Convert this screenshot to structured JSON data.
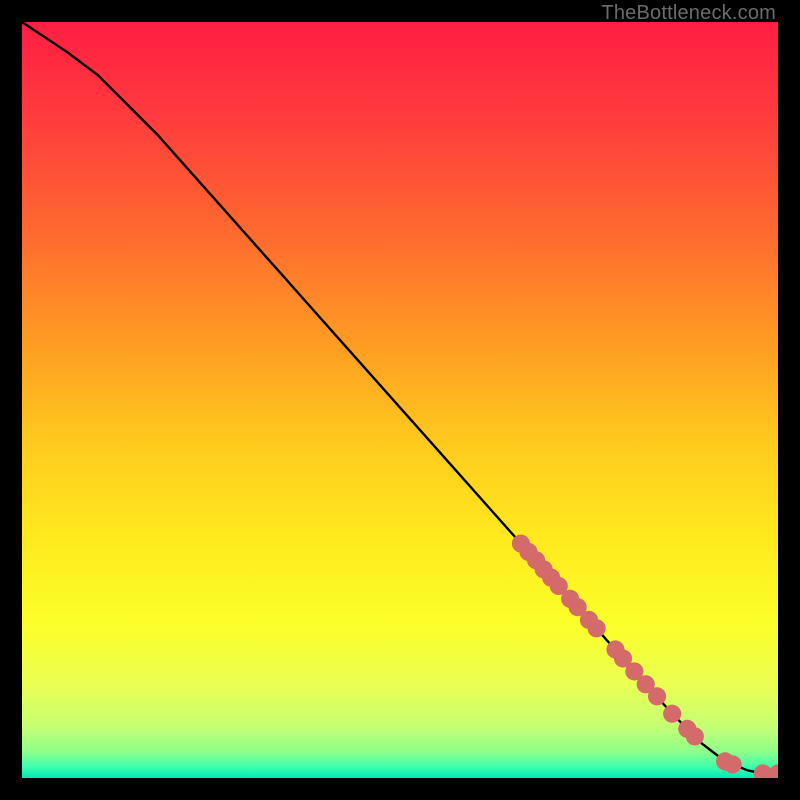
{
  "watermark": "TheBottleneck.com",
  "chart_data": {
    "type": "line",
    "title": "",
    "xlabel": "",
    "ylabel": "",
    "xlim": [
      0,
      100
    ],
    "ylim": [
      0,
      100
    ],
    "curve": {
      "name": "bottleneck-curve",
      "x": [
        0,
        3,
        6,
        10,
        14,
        18,
        22,
        26,
        30,
        34,
        38,
        42,
        46,
        50,
        54,
        58,
        62,
        66,
        70,
        74,
        78,
        82,
        86,
        90,
        93,
        96,
        98,
        100
      ],
      "y": [
        100,
        98,
        96,
        93,
        89,
        85,
        80.5,
        76,
        71.5,
        67,
        62.5,
        58,
        53.5,
        49,
        44.5,
        40,
        35.5,
        31,
        26.5,
        22,
        17.5,
        13,
        8.5,
        4.5,
        2.2,
        1.0,
        0.6,
        0.6
      ]
    },
    "markers": {
      "name": "highlighted-points",
      "color": "#d46a6a",
      "radius_frac": 0.012,
      "points_xy": [
        [
          66,
          31.0
        ],
        [
          67,
          29.9
        ],
        [
          68,
          28.8
        ],
        [
          69,
          27.6
        ],
        [
          70,
          26.5
        ],
        [
          71,
          25.4
        ],
        [
          72.5,
          23.7
        ],
        [
          73.5,
          22.6
        ],
        [
          75,
          20.9
        ],
        [
          76,
          19.8
        ],
        [
          78.5,
          17.0
        ],
        [
          79.5,
          15.8
        ],
        [
          81,
          14.1
        ],
        [
          82.5,
          12.4
        ],
        [
          84,
          10.8
        ],
        [
          86,
          8.5
        ],
        [
          88,
          6.5
        ],
        [
          89,
          5.5
        ],
        [
          93,
          2.2
        ],
        [
          94,
          1.8
        ],
        [
          98,
          0.6
        ],
        [
          100,
          0.6
        ]
      ]
    },
    "gradient_stops": [
      {
        "offset": 0.0,
        "color": "#ff1e42"
      },
      {
        "offset": 0.12,
        "color": "#ff3a3e"
      },
      {
        "offset": 0.28,
        "color": "#ff6a2f"
      },
      {
        "offset": 0.42,
        "color": "#ff9a23"
      },
      {
        "offset": 0.55,
        "color": "#ffc81e"
      },
      {
        "offset": 0.68,
        "color": "#ffe91e"
      },
      {
        "offset": 0.8,
        "color": "#fbff2a"
      },
      {
        "offset": 0.88,
        "color": "#e8ff55"
      },
      {
        "offset": 0.93,
        "color": "#c7ff72"
      },
      {
        "offset": 0.965,
        "color": "#8fff8a"
      },
      {
        "offset": 0.985,
        "color": "#3fffad"
      },
      {
        "offset": 1.0,
        "color": "#00e8b5"
      }
    ]
  }
}
